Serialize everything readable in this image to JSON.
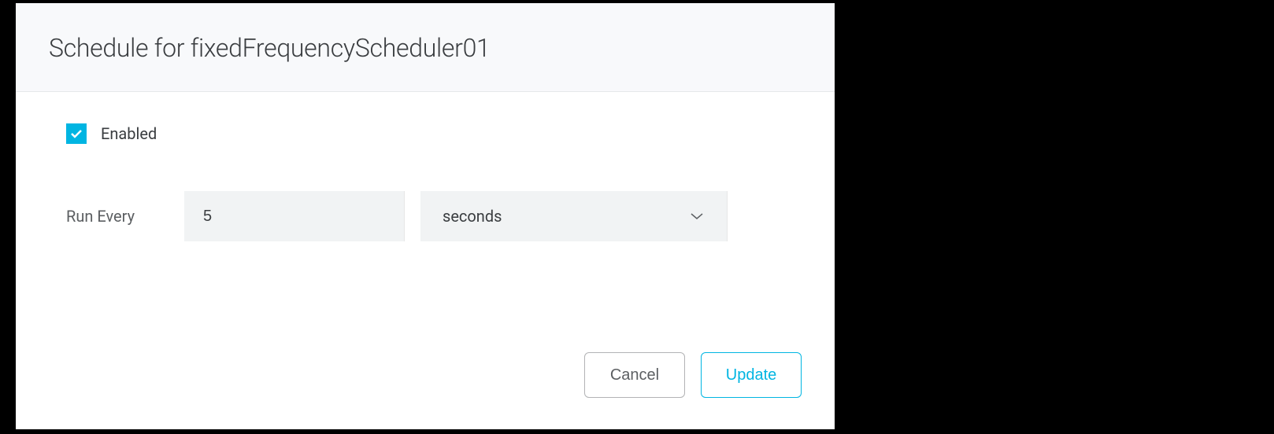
{
  "dialog": {
    "title": "Schedule for fixedFrequencyScheduler01",
    "enabled": {
      "checked": true,
      "label": "Enabled"
    },
    "runEvery": {
      "label": "Run Every",
      "value": "5",
      "unit": "seconds"
    },
    "buttons": {
      "cancel": "Cancel",
      "update": "Update"
    }
  },
  "colors": {
    "accent": "#00b5e2"
  }
}
